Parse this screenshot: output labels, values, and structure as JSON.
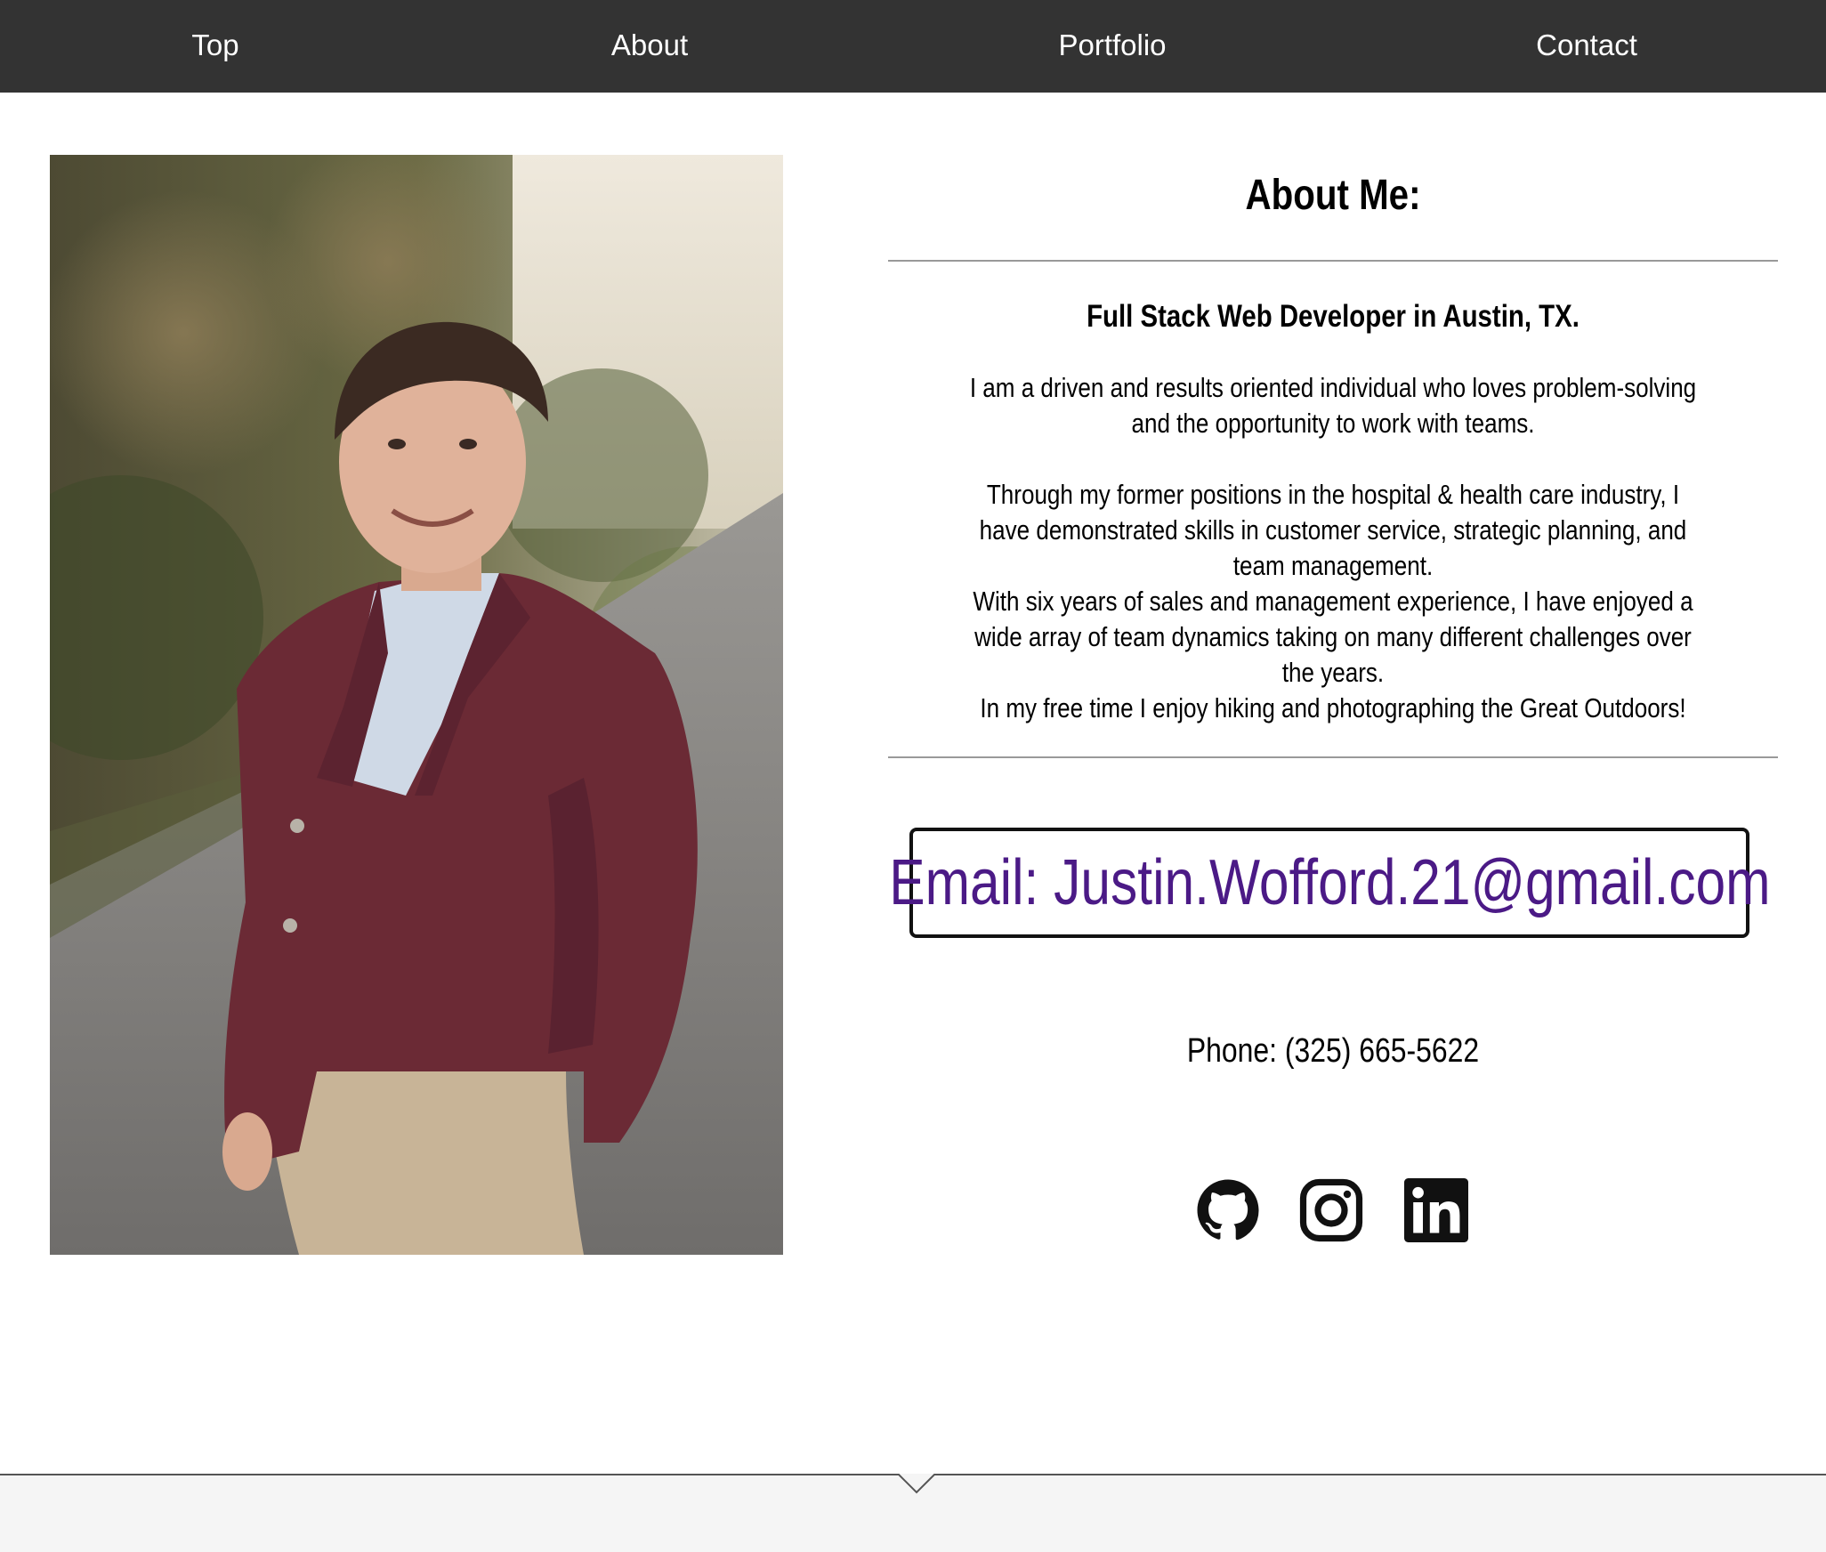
{
  "nav": {
    "items": [
      {
        "label": "Top"
      },
      {
        "label": "About"
      },
      {
        "label": "Portfolio"
      },
      {
        "label": "Contact"
      }
    ]
  },
  "about": {
    "title": "About Me:",
    "subtitle": "Full Stack Web Developer in Austin, TX.",
    "paragraphs": [
      "I am a driven and results oriented individual who loves problem-solving and the opportunity to work with teams.",
      "Through my former positions in the hospital & health care industry, I have demonstrated skills in customer service, strategic planning, and team management.",
      "With six years of sales and management experience, I have enjoyed a wide array of team dynamics taking on many different challenges over the years.",
      "In my free time I enjoy hiking and photographing the Great Outdoors!"
    ]
  },
  "contact": {
    "email": "Email: Justin.Wofford.21@gmail.com",
    "phone": "Phone: (325) 665-5622"
  },
  "social": {
    "icons": [
      "github-icon",
      "instagram-icon",
      "linkedin-icon"
    ]
  },
  "colors": {
    "nav_bg": "#333333",
    "email_text": "#4b1a86",
    "footer_bg": "#f5f5f5"
  }
}
